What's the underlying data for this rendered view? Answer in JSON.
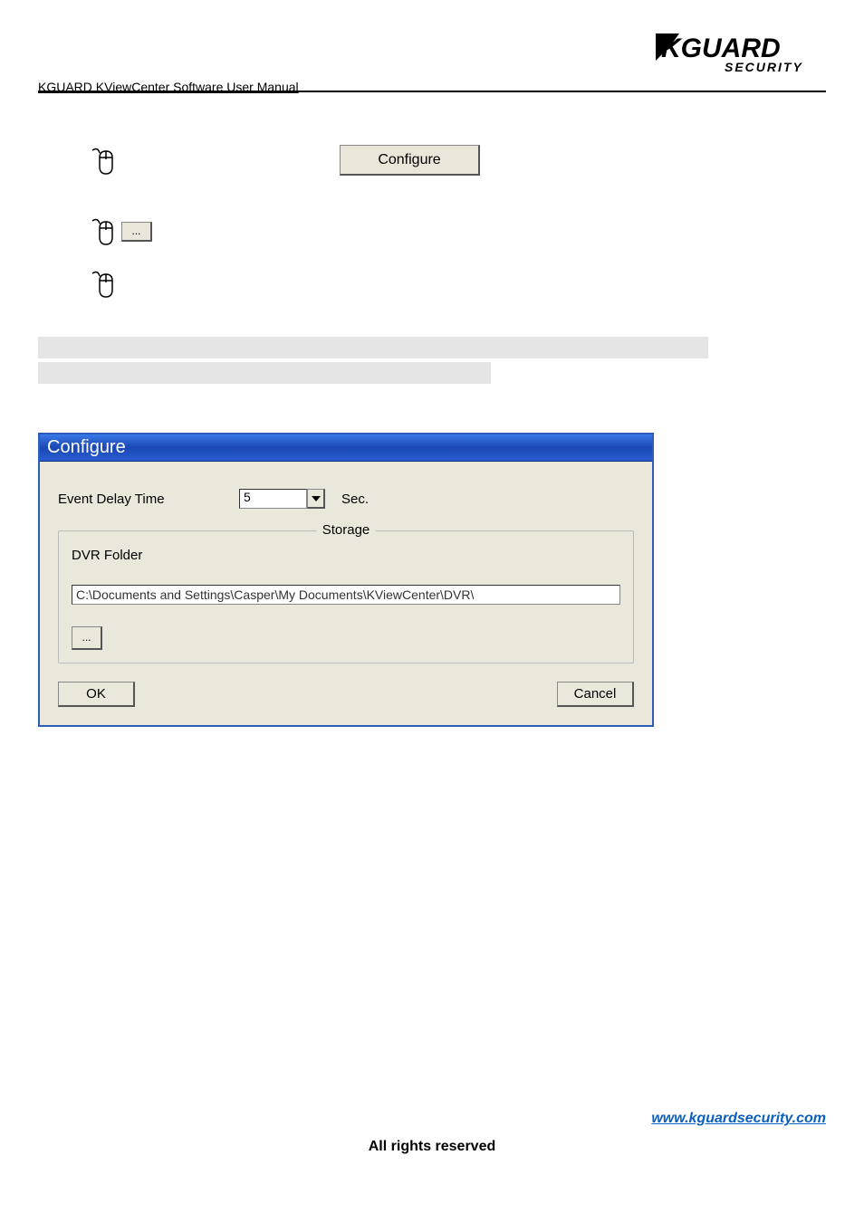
{
  "header": {
    "title": "KGUARD KViewCenter Software User Manual",
    "logo_main": "KGUARD",
    "logo_sub": "SECURITY"
  },
  "buttons": {
    "configure": "Configure",
    "browse_small": "...",
    "ok": "OK",
    "cancel": "Cancel",
    "browse": "..."
  },
  "dialog": {
    "title": "Configure",
    "event_delay_label": "Event Delay Time",
    "event_delay_value": "5",
    "sec_label": "Sec.",
    "storage_legend": "Storage",
    "dvr_folder_label": "DVR Folder",
    "path": "C:\\Documents and Settings\\Casper\\My Documents\\KViewCenter\\DVR\\"
  },
  "footer": {
    "link": "www.kguardsecurity.com",
    "rights": "All rights reserved"
  }
}
